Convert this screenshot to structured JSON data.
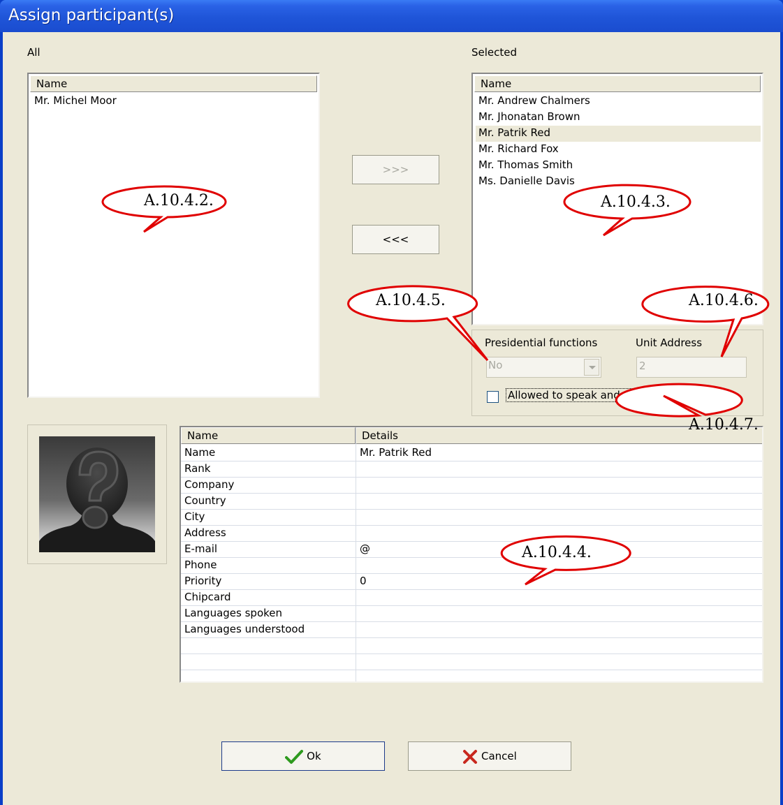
{
  "window": {
    "title": "Assign participant(s)"
  },
  "all_panel": {
    "label": "All",
    "header": "Name",
    "items": [
      "Mr. Michel Moor"
    ]
  },
  "selected_panel": {
    "label": "Selected",
    "header": "Name",
    "items": [
      "Mr. Andrew Chalmers",
      "Mr. Jhonatan Brown",
      "Mr. Patrik Red",
      "Mr. Richard Fox",
      "Mr. Thomas Smith",
      "Ms. Danielle Davis"
    ],
    "selected_index": 2
  },
  "transfer": {
    "add_label": ">>>",
    "remove_label": "<<<"
  },
  "settings": {
    "presidential_label": "Presidential functions",
    "presidential_value": "No",
    "unit_address_label": "Unit Address",
    "unit_address_value": "2",
    "allowed_label": "Allowed to speak and vote",
    "allowed_checked": false
  },
  "details": {
    "col_name": "Name",
    "col_details": "Details",
    "rows": [
      {
        "name": "Name",
        "value": "Mr. Patrik Red"
      },
      {
        "name": "Rank",
        "value": ""
      },
      {
        "name": "Company",
        "value": ""
      },
      {
        "name": "Country",
        "value": ""
      },
      {
        "name": "City",
        "value": ""
      },
      {
        "name": "Address",
        "value": ""
      },
      {
        "name": "E-mail",
        "value": "@"
      },
      {
        "name": "Phone",
        "value": ""
      },
      {
        "name": "Priority",
        "value": "0"
      },
      {
        "name": "Chipcard",
        "value": ""
      },
      {
        "name": "Languages spoken",
        "value": ""
      },
      {
        "name": "Languages understood",
        "value": ""
      },
      {
        "name": "",
        "value": ""
      },
      {
        "name": "",
        "value": ""
      },
      {
        "name": "",
        "value": ""
      }
    ]
  },
  "buttons": {
    "ok_label": "Ok",
    "cancel_label": "Cancel"
  },
  "callouts": {
    "c2": "A.10.4.2.",
    "c3": "A.10.4.3.",
    "c4": "A.10.4.4.",
    "c5": "A.10.4.5.",
    "c6": "A.10.4.6.",
    "c7": "A.10.4.7."
  },
  "icons": {
    "ok": "checkmark-icon",
    "cancel": "x-icon",
    "photo": "unknown-person-icon"
  },
  "colors": {
    "titlebar": "#1f55d8",
    "dialog_bg": "#ece9d8",
    "callout_stroke": "#e00000",
    "ok_check": "#2e9a1e",
    "cancel_x": "#c8281e"
  }
}
